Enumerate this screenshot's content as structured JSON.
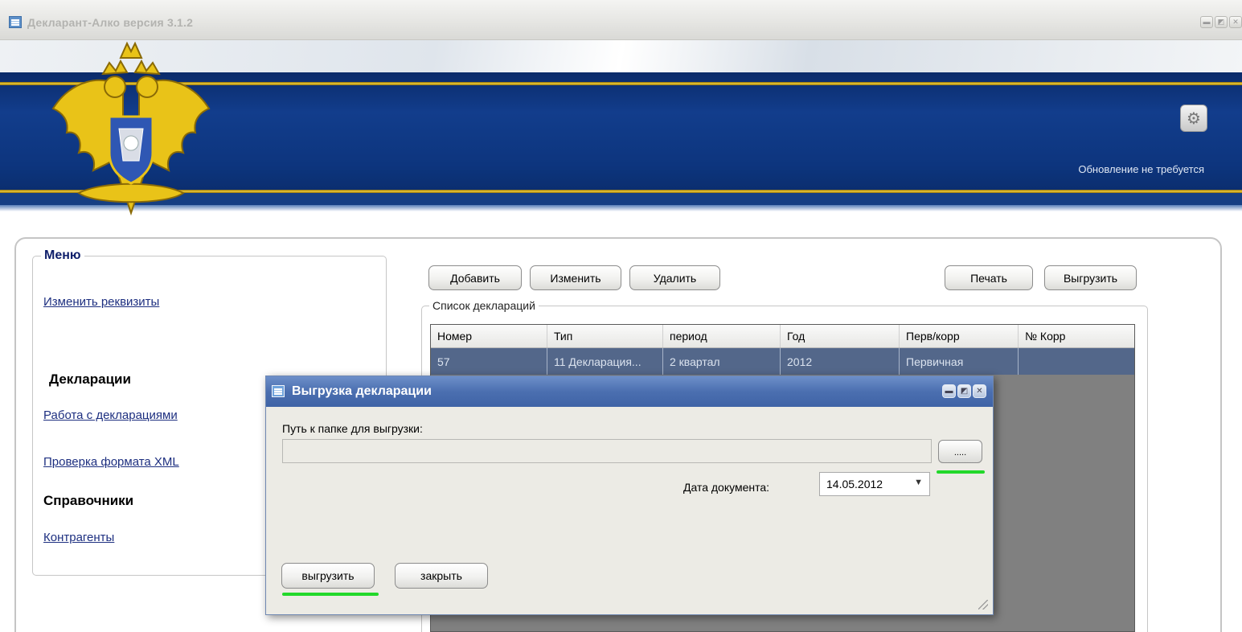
{
  "window": {
    "title": "Декларант-Алко версия 3.1.2",
    "controls": [
      "minimize",
      "maximize",
      "close"
    ]
  },
  "header": {
    "update_status": "Обновление не требуется",
    "settings_icon": "gear-icon",
    "emblem": "double-headed-eagle-emblem",
    "colors": {
      "banner_blue": "#123d8c",
      "gold": "#f0cf39"
    }
  },
  "menu": {
    "title": "Меню",
    "items": [
      {
        "label": "Изменить реквизиты"
      }
    ],
    "sections": [
      {
        "title": "Декларации",
        "items": [
          {
            "label": "Работа с декларациями"
          },
          {
            "label": "Проверка формата XML"
          }
        ]
      },
      {
        "title": "Справочники",
        "items": [
          {
            "label": "Контрагенты"
          }
        ]
      }
    ]
  },
  "toolbar": {
    "add": "Добавить",
    "edit": "Изменить",
    "delete": "Удалить",
    "print": "Печать",
    "export": "Выгрузить"
  },
  "declarations": {
    "title": "Список деклараций",
    "columns": [
      "Номер",
      "Тип",
      "период",
      "Год",
      "Перв/корр",
      "№ Корр"
    ],
    "rows": [
      [
        "57",
        "11 Декларация...",
        "2 квартал",
        "2012",
        "Первичная",
        ""
      ]
    ],
    "selected_row_color": "#53678a"
  },
  "dialog": {
    "title": "Выгрузка декларации",
    "path_label": "Путь к папке для выгрузки:",
    "path_value": "",
    "browse_label": ".....",
    "date_label": "Дата документа:",
    "date_value": "14.05.2012",
    "export_label": "выгрузить",
    "close_label": "закрыть",
    "highlight_color": "#22d82a"
  }
}
